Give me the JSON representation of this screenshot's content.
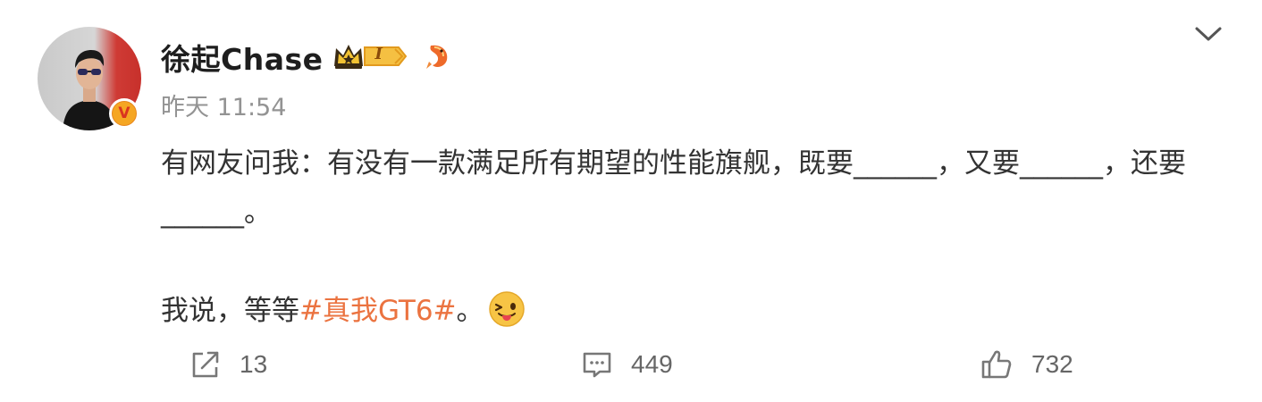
{
  "user": {
    "name": "徐起Chase",
    "badge_level": "I",
    "verified_mark": "V"
  },
  "post": {
    "timestamp": "昨天 11:54",
    "paragraph1": "有网友问我：有没有一款满足所有期望的性能旗舰，既要______，又要______，还要______。",
    "paragraph2_prefix": "我说，等等",
    "hashtag": "#真我GT6#",
    "paragraph2_suffix": "。"
  },
  "actions": {
    "repost_count": "13",
    "comment_count": "449",
    "like_count": "732"
  },
  "colors": {
    "hashtag": "#eb7340",
    "timestamp": "#939393",
    "badge_orange": "#f5a623"
  },
  "icons": {
    "more": "chevron-down-icon",
    "repost": "share-icon",
    "comment": "comment-icon",
    "like": "thumbs-up-icon",
    "crown": "crown-badge-icon",
    "fish": "fish-badge-icon",
    "emoji": "tongue-wink-emoji"
  }
}
